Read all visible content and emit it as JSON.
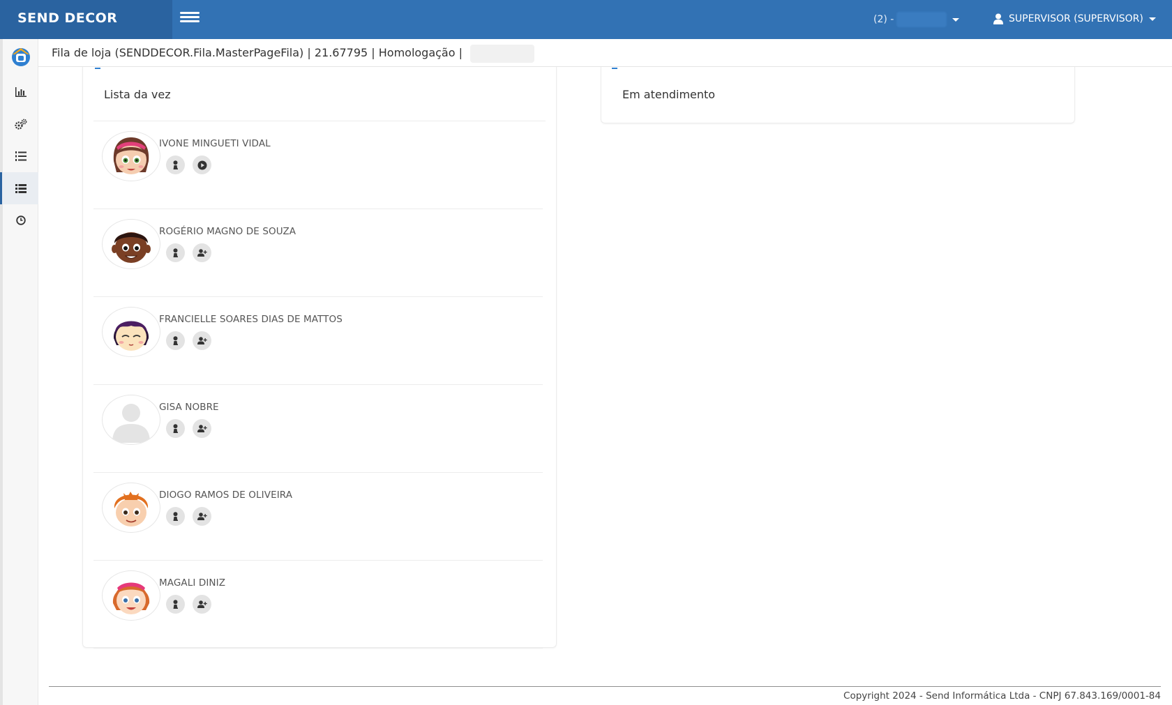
{
  "header": {
    "brand": "SEND DECOR",
    "store_label": "(2) -",
    "user_label": "SUPERVISOR (SUPERVISOR)"
  },
  "breadcrumb": {
    "text": "Fila de loja (SENDDECOR.Fila.MasterPageFila) | 21.67795 | Homologação |"
  },
  "sidebar": {
    "items": [
      {
        "icon": "home-logo-icon"
      },
      {
        "icon": "bar-chart-icon"
      },
      {
        "icon": "gears-icon"
      },
      {
        "icon": "numbered-list-icon"
      },
      {
        "icon": "list-icon",
        "active": true
      },
      {
        "icon": "clock-icon"
      }
    ]
  },
  "queue_panel": {
    "title": "Lista da vez",
    "rows": [
      {
        "name": "IVONE MINGUETI VIDAL",
        "avatar": "girl-avatar",
        "actions": [
          "user-icon",
          "play-icon"
        ]
      },
      {
        "name": "ROGÉRIO MAGNO DE SOUZA",
        "avatar": "boy-dark-avatar",
        "actions": [
          "user-icon",
          "user-plus-icon"
        ]
      },
      {
        "name": "FRANCIELLE SOARES DIAS DE MATTOS",
        "avatar": "girl-purple-avatar",
        "actions": [
          "user-icon",
          "user-plus-icon"
        ]
      },
      {
        "name": "GISA NOBRE",
        "avatar": "placeholder-avatar",
        "actions": [
          "user-icon",
          "user-plus-icon"
        ]
      },
      {
        "name": "DIOGO RAMOS DE OLIVEIRA",
        "avatar": "boy-ginger-avatar",
        "actions": [
          "user-icon",
          "user-plus-icon"
        ]
      },
      {
        "name": "MAGALI DINIZ",
        "avatar": "girl-ginger-avatar",
        "actions": [
          "user-icon",
          "user-plus-icon"
        ]
      }
    ]
  },
  "service_panel": {
    "title": "Em atendimento"
  },
  "footer": {
    "copyright": "Copyright 2024 - Send Informática Ltda - CNPJ 67.843.169/0001-84"
  },
  "colors": {
    "topbar": "#3272b4",
    "brand_bg": "#2a63a0",
    "accent": "#2f80d1"
  }
}
